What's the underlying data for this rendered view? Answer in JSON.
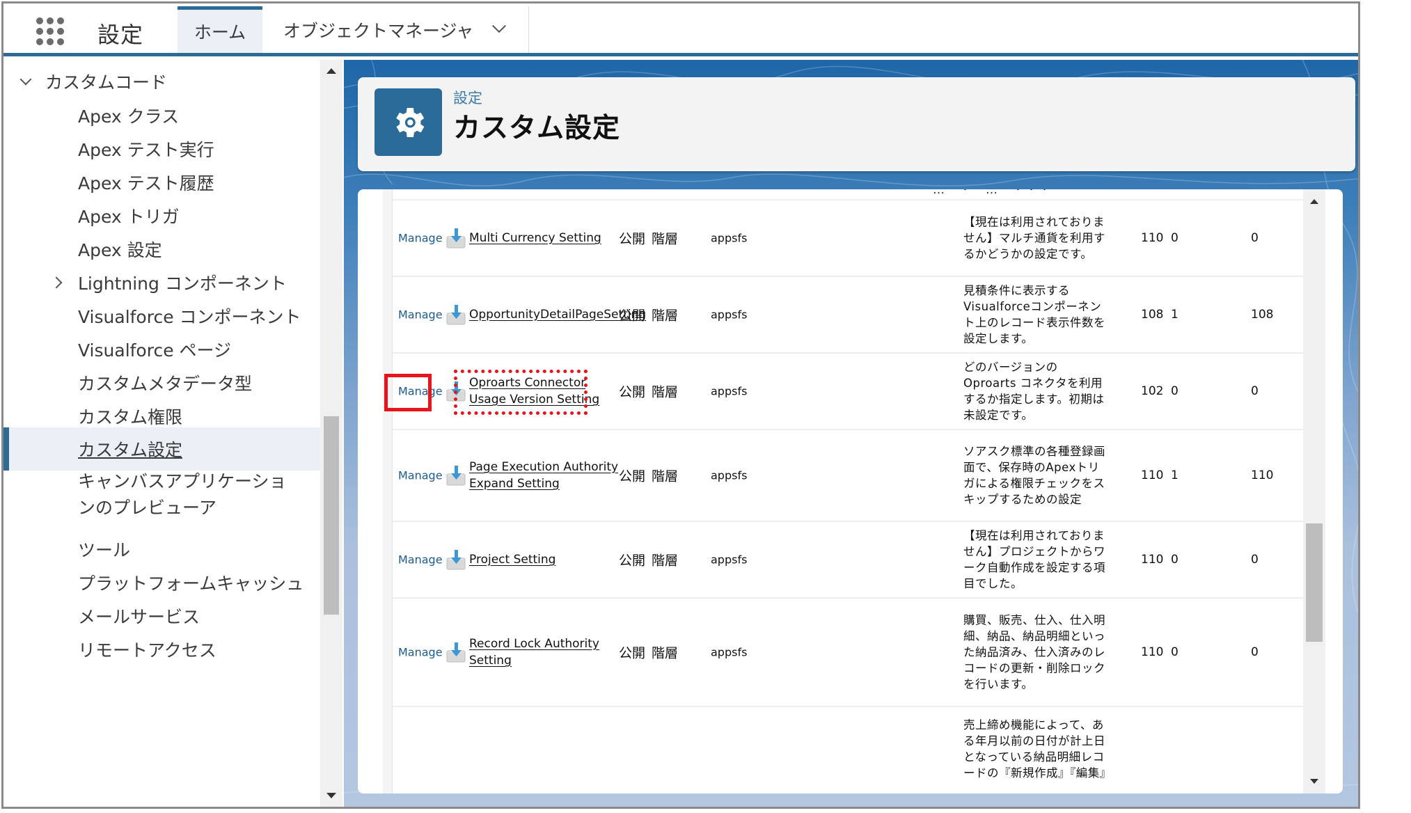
{
  "topbar": {
    "app_launcher_icon": "app-launcher-grid-icon",
    "app_name": "設定",
    "tabs": [
      {
        "label": "ホーム",
        "active": true
      },
      {
        "label": "オブジェクトマネージャ",
        "active": false,
        "has_dropdown": true
      }
    ]
  },
  "sidebar": {
    "items": [
      {
        "label": "カスタムコード",
        "type": "group",
        "expanded": true
      },
      {
        "label": "Apex クラス"
      },
      {
        "label": "Apex テスト実行"
      },
      {
        "label": "Apex テスト履歴"
      },
      {
        "label": "Apex トリガ"
      },
      {
        "label": "Apex 設定"
      },
      {
        "label": "Lightning コンポーネント",
        "collapsed": true
      },
      {
        "label": "Visualforce コンポーネント"
      },
      {
        "label": "Visualforce ページ"
      },
      {
        "label": "カスタムメタデータ型"
      },
      {
        "label": "カスタム権限"
      },
      {
        "label": "カスタム設定",
        "selected": true
      },
      {
        "label": "キャンバスアプリケーションのプレビューア"
      },
      {
        "label": "ツール"
      },
      {
        "label": "プラットフォームキャッシュ"
      },
      {
        "label": "メールサービス"
      },
      {
        "label": "リモートアクセス"
      }
    ]
  },
  "page_header": {
    "icon": "gear-icon",
    "eyebrow": "設定",
    "title": "カスタム設定"
  },
  "table": {
    "cut_row_fragment": "…ー・ー…ー・・・",
    "rows": [
      {
        "action": "Manage",
        "icon": "installed-package-icon",
        "label": "Multi Currency Setting",
        "visibility": "公開",
        "setting_type": "階層",
        "namespace": "appsfs",
        "description": "【現在は利用されておりません】マルチ通貨を利用するかどうかの設定です。",
        "size": "110",
        "records": "0",
        "total": "0"
      },
      {
        "action": "Manage",
        "icon": "installed-package-icon",
        "label": "OpportunityDetailPageSetting",
        "visibility": "公開",
        "setting_type": "階層",
        "namespace": "appsfs",
        "description": "見積条件に表示するVisualforceコンポーネント上のレコード表示件数を設定します。",
        "size": "108",
        "records": "1",
        "total": "108"
      },
      {
        "action": "Manage",
        "icon": "installed-package-icon",
        "label": "Oproarts Connector Usage Version Setting",
        "visibility": "公開",
        "setting_type": "階層",
        "namespace": "appsfs",
        "description": "どのバージョンのOproarts コネクタを利用するか指定します。初期は未設定です。",
        "size": "102",
        "records": "0",
        "total": "0",
        "highlighted": true
      },
      {
        "action": "Manage",
        "icon": "installed-package-icon",
        "label": "Page Execution Authority Expand Setting",
        "visibility": "公開",
        "setting_type": "階層",
        "namespace": "appsfs",
        "description": "ソアスク標準の各種登録画面で、保存時のApexトリガによる権限チェックをスキップするための設定",
        "size": "110",
        "records": "1",
        "total": "110"
      },
      {
        "action": "Manage",
        "icon": "installed-package-icon",
        "label": "Project Setting",
        "visibility": "公開",
        "setting_type": "階層",
        "namespace": "appsfs",
        "description": "【現在は利用されておりません】プロジェクトからワーク自動作成を設定する項目でした。",
        "size": "110",
        "records": "0",
        "total": "0"
      },
      {
        "action": "Manage",
        "icon": "installed-package-icon",
        "label": "Record Lock Authority Setting",
        "visibility": "公開",
        "setting_type": "階層",
        "namespace": "appsfs",
        "description": "購買、販売、仕入、仕入明細、納品、納品明細といった納品済み、仕入済みのレコードの更新・削除ロックを行います。",
        "size": "110",
        "records": "0",
        "total": "0"
      },
      {
        "action": "",
        "icon": "",
        "label": "",
        "visibility": "",
        "setting_type": "",
        "namespace": "",
        "description": "売上締め機能によって、ある年月以前の日付が計上日となっている納品明細レコードの『新規作成』『編集』",
        "size": "",
        "records": "",
        "total": ""
      }
    ]
  },
  "colors": {
    "brand_blue": "#2e6a96",
    "link_blue": "#1b5b8e",
    "highlight_red": "#e8141b",
    "selected_bg": "#eaf0f5"
  }
}
